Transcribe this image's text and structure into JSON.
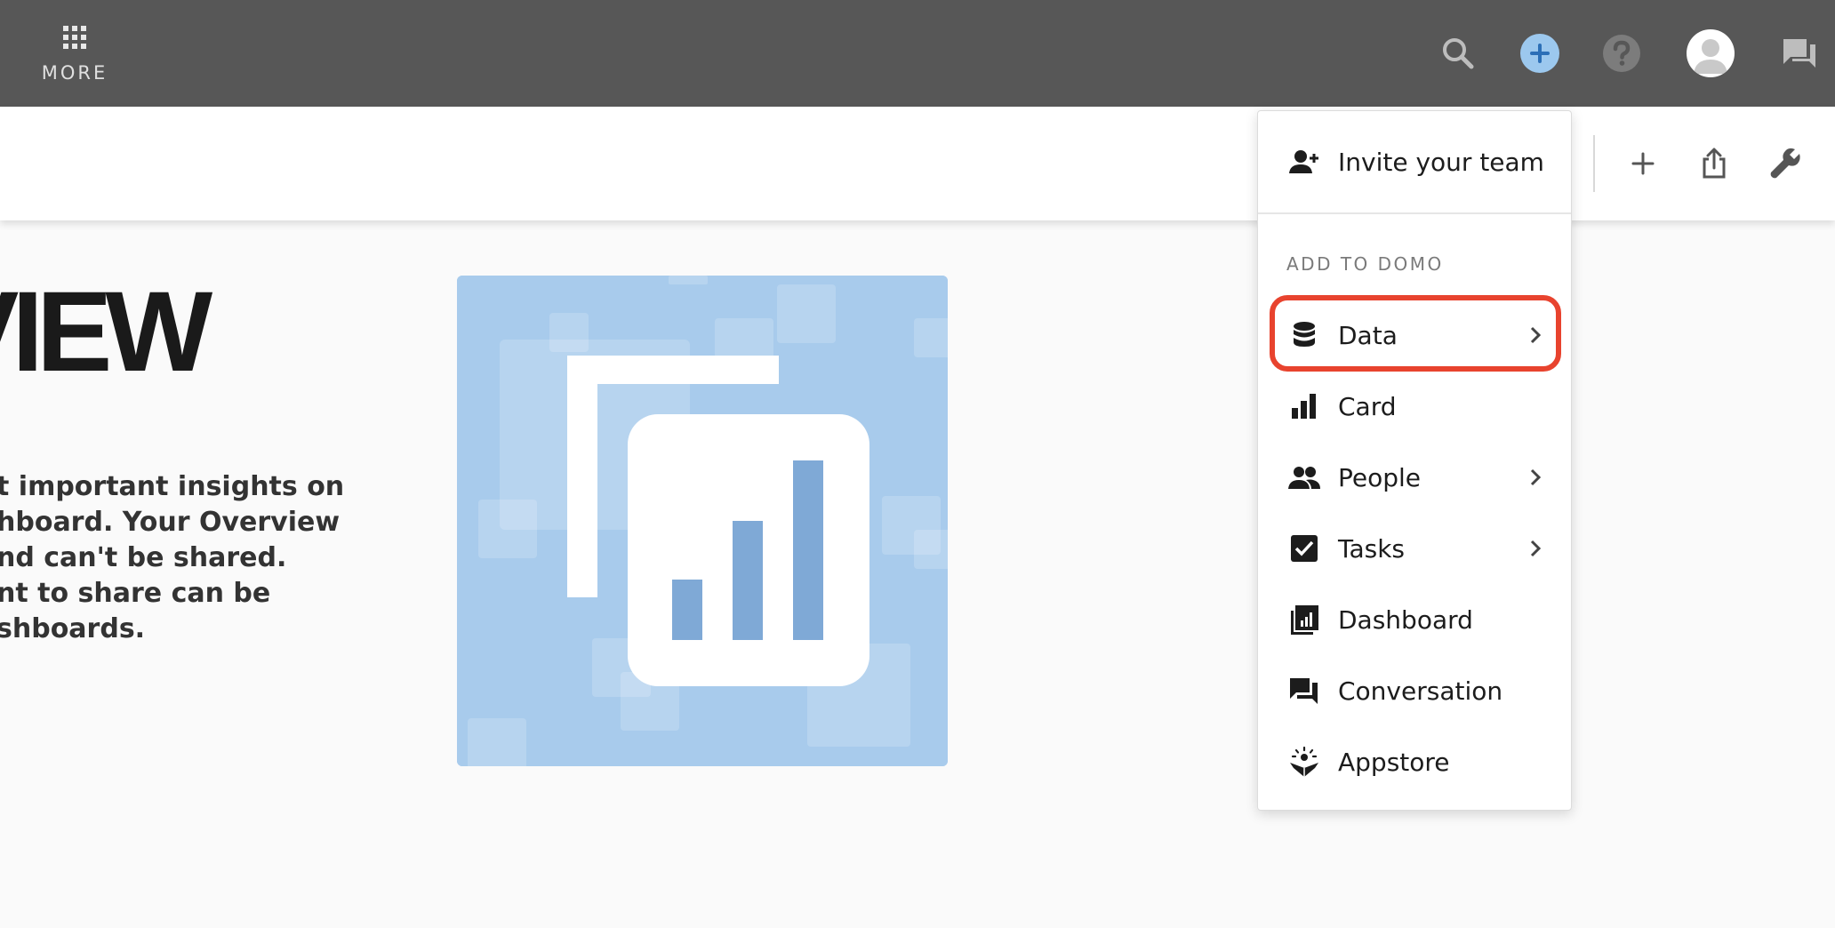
{
  "topbar": {
    "more_label": "MORE",
    "icons": [
      "search-icon",
      "add-icon",
      "help-icon",
      "avatar",
      "chat-icon"
    ]
  },
  "subbar": {
    "icons": [
      "plus-icon",
      "share-icon",
      "wrench-icon"
    ]
  },
  "page": {
    "title": "VIEW",
    "description_lines": [
      "t important insights on",
      "hboard. Your Overview",
      "nd can't be shared.",
      "nt to share can be",
      "shboards."
    ]
  },
  "dropdown": {
    "invite_label": "Invite your team",
    "section_title": "ADD TO DOMO",
    "items": [
      {
        "label": "Data",
        "icon": "database-icon",
        "has_submenu": true,
        "highlighted": true
      },
      {
        "label": "Card",
        "icon": "bar-chart-icon",
        "has_submenu": false
      },
      {
        "label": "People",
        "icon": "people-icon",
        "has_submenu": true
      },
      {
        "label": "Tasks",
        "icon": "checkbox-icon",
        "has_submenu": true
      },
      {
        "label": "Dashboard",
        "icon": "dashboard-icon",
        "has_submenu": false
      },
      {
        "label": "Conversation",
        "icon": "conversation-icon",
        "has_submenu": false
      },
      {
        "label": "Appstore",
        "icon": "appstore-icon",
        "has_submenu": false
      }
    ]
  },
  "colors": {
    "topbar": "#575757",
    "accent_blue": "#9cc8ee",
    "highlight": "#e8432e",
    "illustration_bg": "#a8cbec"
  }
}
